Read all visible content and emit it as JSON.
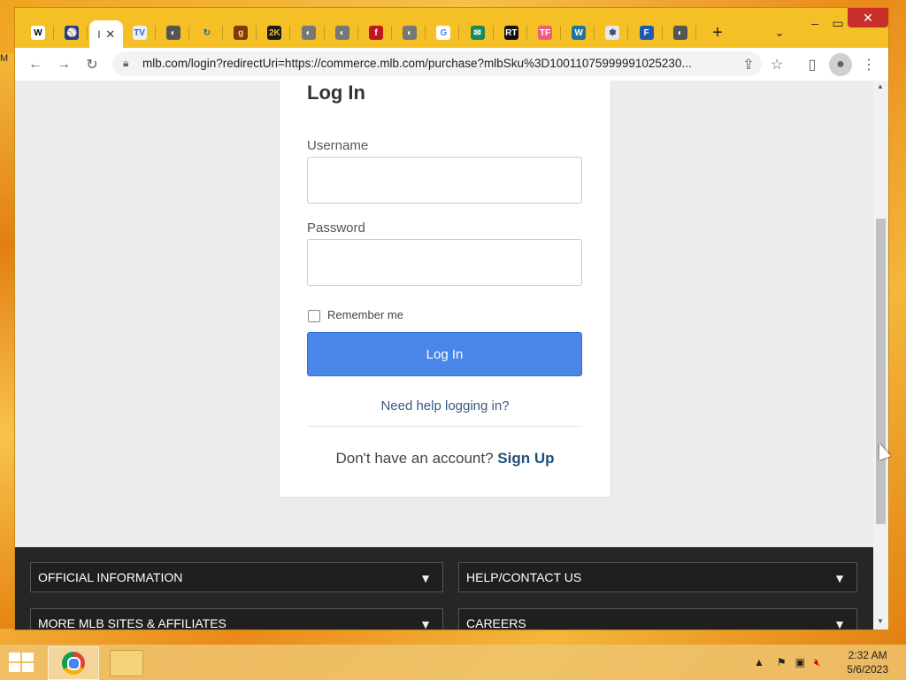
{
  "browser": {
    "url": "mlb.com/login?redirectUri=https://commerce.mlb.com/purchase?mlbSku%3D10011075999991025230...",
    "active_tab_glyph": "l",
    "tabs": [
      {
        "icon": "wikipedia-icon",
        "glyph": "W",
        "color": "#ffffff",
        "fg": "#000000"
      },
      {
        "icon": "mlb-icon",
        "glyph": "⚾",
        "color": "#1d3f8a",
        "fg": "#ffffff"
      },
      {
        "icon": "active-tab",
        "glyph": "",
        "color": "#ffffff",
        "fg": "#000000"
      },
      {
        "icon": "tv-icon",
        "glyph": "TV",
        "color": "#e8f0fb",
        "fg": "#2a6bbf"
      },
      {
        "icon": "globe-icon",
        "glyph": "◐",
        "color": "#555555",
        "fg": "#ffffff"
      },
      {
        "icon": "refresh-arrow-icon",
        "glyph": "↻",
        "color": "#f4c025",
        "fg": "#1a63b0"
      },
      {
        "icon": "g-icon",
        "glyph": "g",
        "color": "#7b3b10",
        "fg": "#ffd27a"
      },
      {
        "icon": "2k-icon",
        "glyph": "2K",
        "color": "#1a1a1a",
        "fg": "#f4c025"
      },
      {
        "icon": "globe-icon",
        "glyph": "◐",
        "color": "#777777",
        "fg": "#ffffff"
      },
      {
        "icon": "globe-icon",
        "glyph": "◐",
        "color": "#777777",
        "fg": "#ffffff"
      },
      {
        "icon": "f-icon",
        "glyph": "f",
        "color": "#c0161b",
        "fg": "#ffffff"
      },
      {
        "icon": "globe-icon",
        "glyph": "◐",
        "color": "#777777",
        "fg": "#ffffff"
      },
      {
        "icon": "google-icon",
        "glyph": "G",
        "color": "#ffffff",
        "fg": "#4285f4"
      },
      {
        "icon": "mail-icon",
        "glyph": "✉",
        "color": "#1a8a5a",
        "fg": "#ffffff"
      },
      {
        "icon": "rt-icon",
        "glyph": "RT",
        "color": "#111111",
        "fg": "#ffffff"
      },
      {
        "icon": "tf-icon",
        "glyph": "TF",
        "color": "#f25c7a",
        "fg": "#ffffff"
      },
      {
        "icon": "wordpress-icon",
        "glyph": "W",
        "color": "#21759b",
        "fg": "#ffffff"
      },
      {
        "icon": "snowflake-icon",
        "glyph": "✽",
        "color": "#e5e9ee",
        "fg": "#3a4f6a"
      },
      {
        "icon": "fan-icon",
        "glyph": "F",
        "color": "#1c59b5",
        "fg": "#ffffff"
      },
      {
        "icon": "globe-icon",
        "glyph": "◐",
        "color": "#555555",
        "fg": "#ffffff"
      }
    ],
    "side_label": "M"
  },
  "login": {
    "title": "Log In",
    "username_label": "Username",
    "password_label": "Password",
    "remember_label": "Remember me",
    "login_button": "Log In",
    "help_link": "Need help logging in?",
    "signup_prompt": "Don't have an account?",
    "signup_link": "Sign Up"
  },
  "footer": {
    "items": [
      "OFFICIAL INFORMATION",
      "HELP/CONTACT US",
      "MORE MLB SITES & AFFILIATES",
      "CAREERS"
    ]
  },
  "taskbar": {
    "time": "2:32 AM",
    "date": "5/6/2023"
  }
}
